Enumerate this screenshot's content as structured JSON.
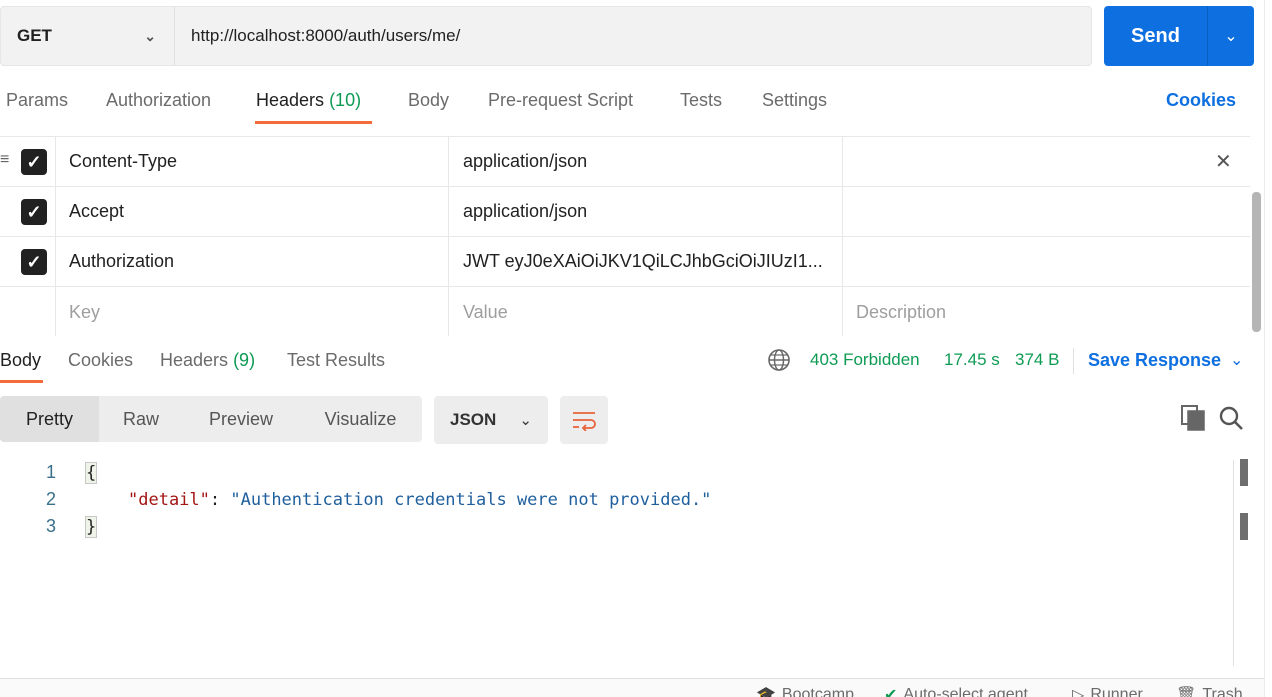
{
  "request": {
    "method": "GET",
    "url": "http://localhost:8000/auth/users/me/",
    "send_label": "Send"
  },
  "request_tabs": [
    {
      "label": "Params"
    },
    {
      "label": "Authorization"
    },
    {
      "label": "Headers",
      "count": "(10)"
    },
    {
      "label": "Body"
    },
    {
      "label": "Pre-request Script"
    },
    {
      "label": "Tests"
    },
    {
      "label": "Settings"
    }
  ],
  "cookies_link": "Cookies",
  "headers": [
    {
      "key": "Content-Type",
      "value": "application/json",
      "checked": true
    },
    {
      "key": "Accept",
      "value": "application/json",
      "checked": true
    },
    {
      "key": "Authorization",
      "value": "JWT eyJ0eXAiOiJKV1QiLCJhbGciOiJIUzI1...",
      "checked": true
    }
  ],
  "header_placeholders": {
    "key": "Key",
    "value": "Value",
    "description": "Description"
  },
  "response_tabs": [
    {
      "label": "Body"
    },
    {
      "label": "Cookies"
    },
    {
      "label": "Headers",
      "count": "(9)"
    },
    {
      "label": "Test Results"
    }
  ],
  "response_meta": {
    "status": "403 Forbidden",
    "time": "17.45 s",
    "size": "374 B",
    "save_label": "Save Response"
  },
  "view_modes": [
    "Pretty",
    "Raw",
    "Preview",
    "Visualize"
  ],
  "format": "JSON",
  "response_body": {
    "line_numbers": [
      "1",
      "2",
      "3"
    ],
    "open_brace": "{",
    "key": "\"detail\"",
    "colon": ": ",
    "value": "\"Authentication credentials were not provided.\"",
    "close_brace": "}"
  },
  "footer": [
    "Bootcamp",
    "Auto-select agent",
    "Runner",
    "Trash"
  ],
  "colors": {
    "accent": "#0d6fe0",
    "tab_underline": "#f26b3a",
    "success": "#0d9b54"
  }
}
